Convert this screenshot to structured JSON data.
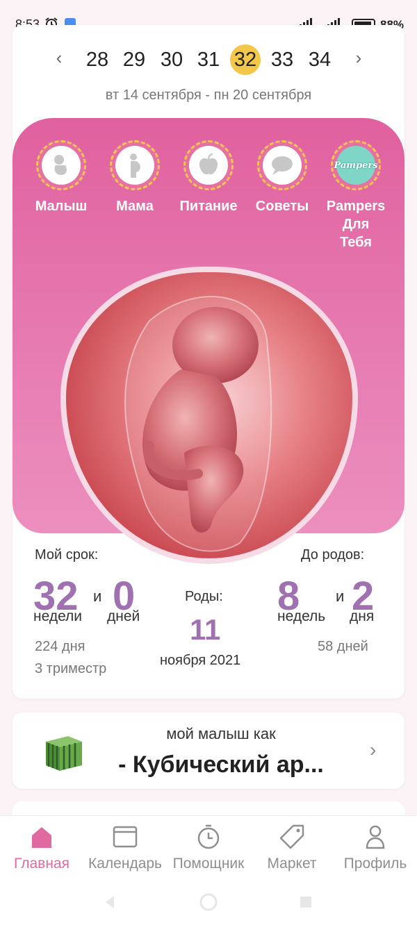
{
  "status": {
    "time": "8:53",
    "battery": "88%"
  },
  "weeks": {
    "prev_icon": "chevron-left-icon",
    "next_icon": "chevron-right-icon",
    "items": [
      "28",
      "29",
      "30",
      "31",
      "32",
      "33",
      "34"
    ],
    "selected": "32",
    "range": "вт 14 сентября - пн 20 сентября"
  },
  "categories": [
    {
      "label": "Малыш",
      "icon": "baby-icon"
    },
    {
      "label": "Мама",
      "icon": "pregnant-woman-icon"
    },
    {
      "label": "Питание",
      "icon": "apple-icon"
    },
    {
      "label": "Советы",
      "icon": "chat-bubble-icon"
    },
    {
      "label": "Pampers\nДля\nТебя",
      "icon": "pampers-logo"
    }
  ],
  "pampers_logo_text": "Pampers",
  "term": {
    "my_term_label": "Мой срок:",
    "weeks_value": "32",
    "weeks_unit": "недели",
    "and": "и",
    "days_value": "0",
    "days_unit": "дней",
    "total_days": "224 дня",
    "trimester": "3 триместр"
  },
  "due": {
    "label": "Роды:",
    "day": "11",
    "month_year": "ноября 2021"
  },
  "remaining": {
    "label": "До родов:",
    "weeks_value": "8",
    "weeks_unit": "недель",
    "and": "и",
    "days_value": "2",
    "days_unit": "дня",
    "total_days": "58 дней"
  },
  "baby_size": {
    "subtitle": "мой малыш как",
    "title": "- Кубический ар..."
  },
  "tabs": [
    {
      "label": "Главная",
      "icon": "home-icon",
      "active": true
    },
    {
      "label": "Календарь",
      "icon": "calendar-icon",
      "active": false
    },
    {
      "label": "Помощник",
      "icon": "timer-icon",
      "active": false
    },
    {
      "label": "Маркет",
      "icon": "tag-icon",
      "active": false
    },
    {
      "label": "Профиль",
      "icon": "profile-icon",
      "active": false
    }
  ],
  "colors": {
    "accent": "#e06a9f",
    "pink_panel": "#e0619f",
    "number_purple": "#a071b1",
    "selected_week": "#f3c749"
  }
}
